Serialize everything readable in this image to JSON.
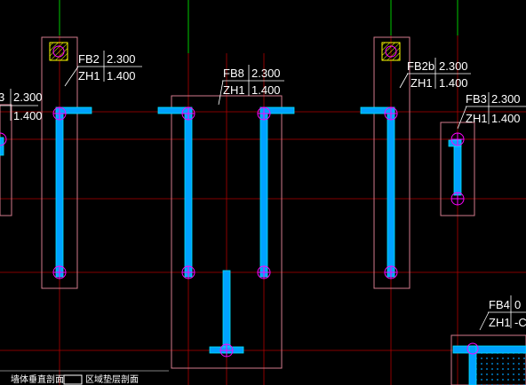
{
  "drawing": {
    "colors": {
      "background": "#000000",
      "axis_green": "#00c800",
      "grid_red": "#b00000",
      "outline_pink": "#d27a8c",
      "wall_cyan": "#00a2ff",
      "wall_edge": "#00e5ff",
      "column_magenta": "#ff00ff",
      "hatch_yellow": "#ffff00",
      "leader_white": "#ffffff"
    },
    "tags": [
      {
        "id": "fb2",
        "code": "FB2",
        "elev": "2.300",
        "sub": "ZH1",
        "subval": "1.400"
      },
      {
        "id": "fb8",
        "code": "FB8",
        "elev": "2.300",
        "sub": "ZH1",
        "subval": "1.400"
      },
      {
        "id": "fb2b",
        "code": "FB2b",
        "elev": "2.300",
        "sub": "ZH1",
        "subval": "1.400"
      },
      {
        "id": "fb3",
        "code": "FB3",
        "elev": "2.300",
        "sub": "ZH1",
        "subval": "1.400"
      },
      {
        "id": "fb3l",
        "code": "3",
        "elev": "2.300",
        "sub": "",
        "subval": "1.400"
      },
      {
        "id": "fb4",
        "code": "FB4",
        "elev": "0",
        "sub": "ZH1",
        "subval": "-C"
      }
    ],
    "footer": {
      "left_text": "墙体垂直剖面",
      "right_text": "区域垫层剖面"
    }
  }
}
